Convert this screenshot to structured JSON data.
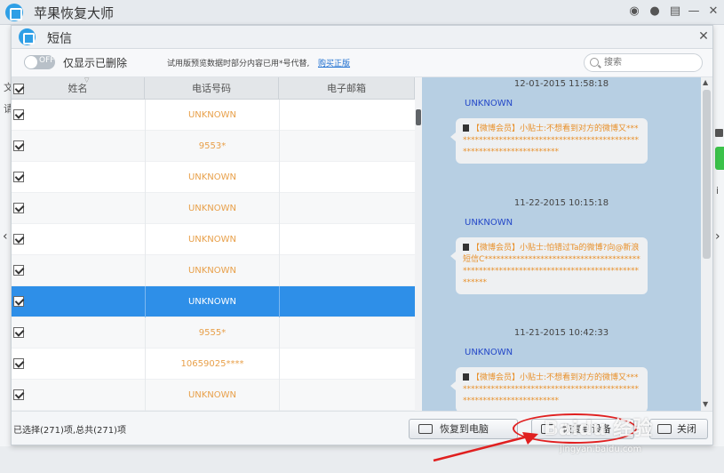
{
  "app": {
    "title": "苹果恢复大师"
  },
  "background": {
    "left_chars": [
      "文",
      "请"
    ],
    "right_char": "i"
  },
  "dialog": {
    "title": "短信",
    "toggle": {
      "state_text": "OFF"
    },
    "filter_label": "仅显示已删除",
    "trial_note": "试用版预览数据时部分内容已用*号代替,",
    "buy_link": "购买正版",
    "search": {
      "placeholder": "搜索"
    },
    "table": {
      "columns": [
        "姓名",
        "电话号码",
        "电子邮箱"
      ],
      "rows": [
        {
          "name": "",
          "phone": "UNKNOWN",
          "email": "",
          "checked": true,
          "selected": false
        },
        {
          "name": "",
          "phone": "9553*",
          "email": "",
          "checked": true,
          "selected": false
        },
        {
          "name": "",
          "phone": "UNKNOWN",
          "email": "",
          "checked": true,
          "selected": false
        },
        {
          "name": "",
          "phone": "UNKNOWN",
          "email": "",
          "checked": true,
          "selected": false
        },
        {
          "name": "",
          "phone": "UNKNOWN",
          "email": "",
          "checked": true,
          "selected": false
        },
        {
          "name": "",
          "phone": "UNKNOWN",
          "email": "",
          "checked": true,
          "selected": false
        },
        {
          "name": "",
          "phone": "UNKNOWN",
          "email": "",
          "checked": true,
          "selected": true
        },
        {
          "name": "",
          "phone": "9555*",
          "email": "",
          "checked": true,
          "selected": false
        },
        {
          "name": "",
          "phone": "10659025****",
          "email": "",
          "checked": true,
          "selected": false
        },
        {
          "name": "",
          "phone": "UNKNOWN",
          "email": "",
          "checked": true,
          "selected": false
        }
      ]
    },
    "messages": [
      {
        "timestamp": "12-01-2015 11:58:18",
        "sender": "UNKNOWN",
        "text": "【微博会员】小贴士:不想看到对方的微博又***********************************************************************"
      },
      {
        "timestamp": "11-22-2015 10:15:18",
        "sender": "UNKNOWN",
        "text": "【微博会员】小贴士:怕错过Ta的微博?向@新浪短信C*****************************************************************************************"
      },
      {
        "timestamp": "11-21-2015 10:42:33",
        "sender": "UNKNOWN",
        "text": "【微博会员】小贴士:不想看到对方的微博又***********************************************************************"
      }
    ],
    "footer": {
      "status": "已选择(271)项,总共(271)项",
      "restore_pc_label": "恢复到电脑",
      "restore_device_label": "恢复到设备",
      "close_label": "关闭"
    }
  },
  "watermark": {
    "main": "Baidu 经验",
    "sub": "jingyan.baidu.com"
  },
  "colors": {
    "selected_row": "#2e8fe8",
    "phone_text": "#e8a04a",
    "pane_bg": "#b7cfe3",
    "sender": "#2448c8",
    "annotation": "#e02020"
  }
}
